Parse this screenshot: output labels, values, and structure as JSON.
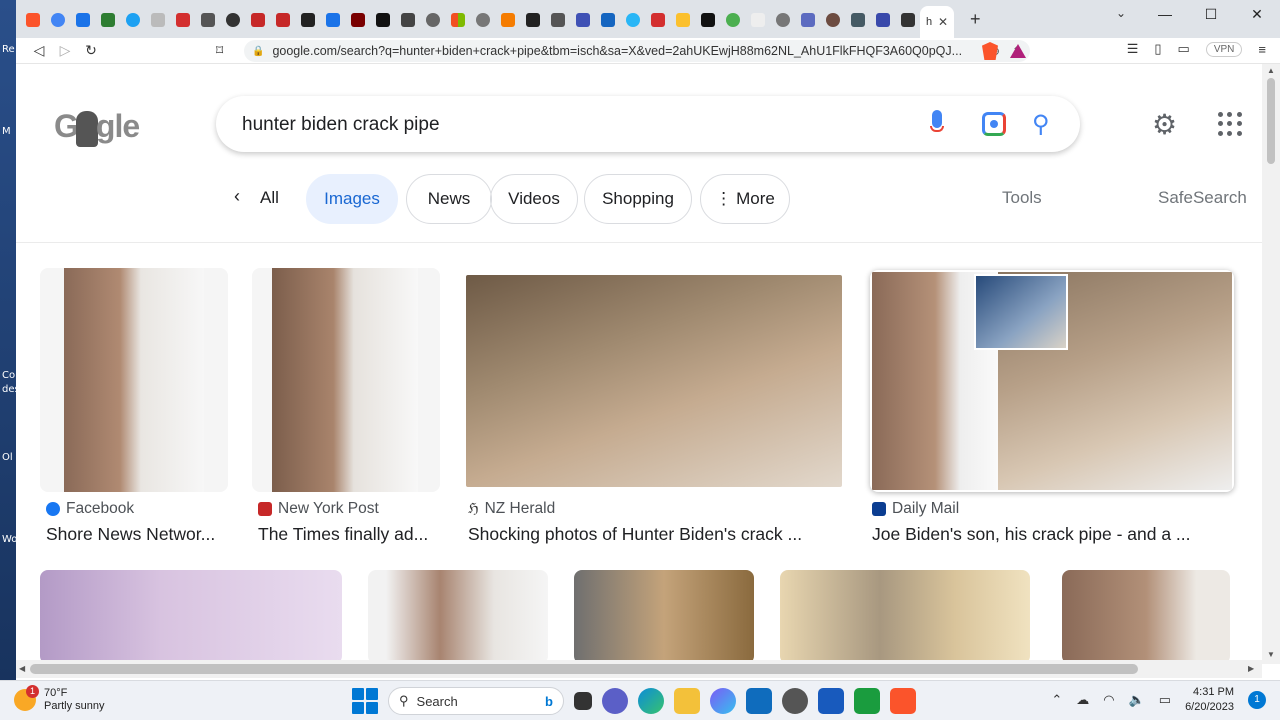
{
  "desktop": {
    "labels": [
      "Re",
      "M",
      "Co",
      "des",
      "Ol",
      "Wo"
    ]
  },
  "browser": {
    "active_tab_label": "h",
    "window_controls": {
      "minimize": "⌄",
      "min": "—",
      "max": "☐",
      "close": "✕"
    },
    "url": "google.com/search?q=hunter+biden+crack+pipe&tbm=isch&sa=X&ved=2ahUKEwjH88m62NL_AhU1FlkFHQF3A60Q0pQJ...",
    "vpn_label": "VPN"
  },
  "google": {
    "logo_text_left": "G",
    "logo_text_right": "gle",
    "query": "hunter biden crack pipe",
    "chips": {
      "back_all": "All",
      "images": "Images",
      "news": "News",
      "videos": "Videos",
      "shopping": "Shopping",
      "more": "More",
      "tools": "Tools",
      "safesearch": "SafeSearch"
    },
    "results": [
      {
        "source": "Facebook",
        "title": "Shore News Networ..."
      },
      {
        "source": "New York Post",
        "title": "The Times finally ad..."
      },
      {
        "source": "NZ Herald",
        "title": "Shocking photos of Hunter Biden's crack ..."
      },
      {
        "source": "Daily Mail",
        "title": "Joe Biden's son, his crack pipe - and a ..."
      }
    ]
  },
  "taskbar": {
    "weather_temp": "70°F",
    "weather_desc": "Partly sunny",
    "weather_badge": "1",
    "search_label": "Search",
    "time": "4:31 PM",
    "date": "6/20/2023",
    "notif_count": "1"
  }
}
